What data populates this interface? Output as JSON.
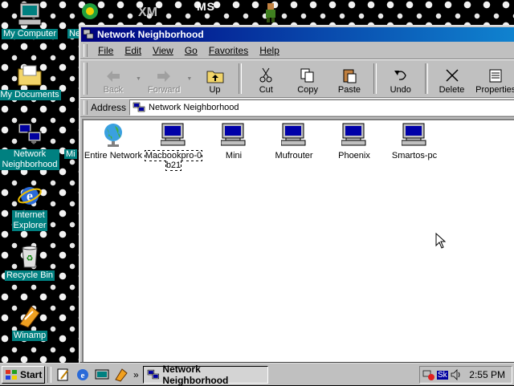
{
  "desktop": {
    "icons": [
      {
        "label": "My Computer",
        "icon": "my-computer-icon"
      },
      {
        "label": "My Documents",
        "icon": "folder-icon"
      },
      {
        "label": "Network\nNeighborhood",
        "icon": "network-neighborhood-icon"
      },
      {
        "label": "Internet\nExplorer",
        "icon": "internet-explorer-icon"
      },
      {
        "label": "Recycle Bin",
        "icon": "recycle-bin-icon"
      },
      {
        "label": "Winamp",
        "icon": "winamp-icon"
      }
    ],
    "partial_labels": {
      "ne": "Ne",
      "mi": "Mi",
      "ms": "MS"
    }
  },
  "window": {
    "title": "Network Neighborhood",
    "menu": [
      "File",
      "Edit",
      "View",
      "Go",
      "Favorites",
      "Help"
    ],
    "toolbar": {
      "back": "Back",
      "forward": "Forward",
      "up": "Up",
      "cut": "Cut",
      "copy": "Copy",
      "paste": "Paste",
      "undo": "Undo",
      "delete": "Delete",
      "properties": "Properties"
    },
    "address_label": "Address",
    "address_value": "Network Neighborhood",
    "items": [
      {
        "label": "Entire Network",
        "icon": "globe-icon"
      },
      {
        "label": "Macbookpro-0\nb21",
        "icon": "computer-icon",
        "selected": true
      },
      {
        "label": "Mini",
        "icon": "computer-icon"
      },
      {
        "label": "Mufrouter",
        "icon": "computer-icon"
      },
      {
        "label": "Phoenix",
        "icon": "computer-icon"
      },
      {
        "label": "Smartos-pc",
        "icon": "computer-icon"
      }
    ]
  },
  "taskbar": {
    "start_label": "Start",
    "task_label": "Network Neighborhood",
    "tray_text": "Sk",
    "clock": "2:55 PM"
  },
  "colors": {
    "title_start": "#000080",
    "title_end": "#1084d0",
    "desktop_label_bg": "#008080",
    "face": "#c0c0c0"
  }
}
